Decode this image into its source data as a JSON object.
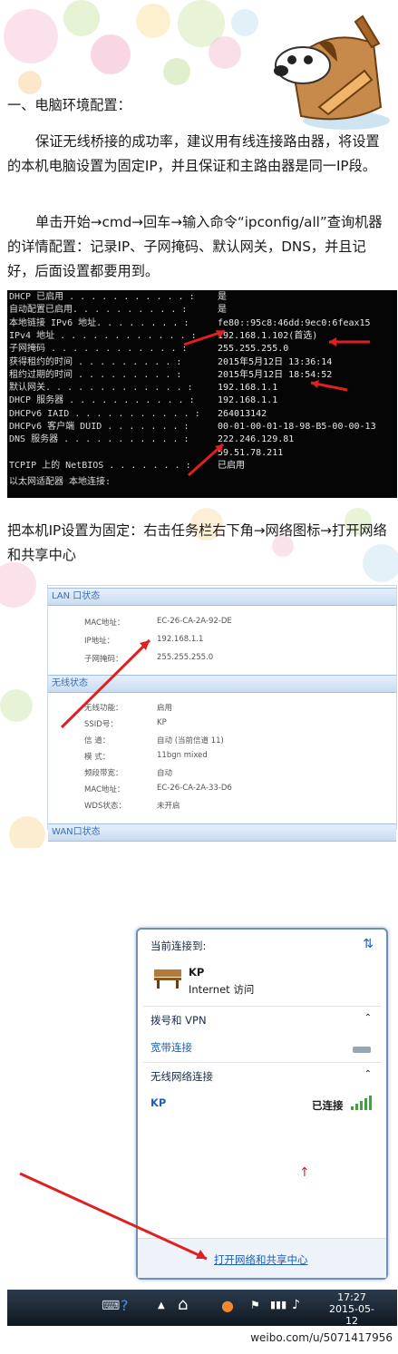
{
  "section_title": "一、电脑环境配置：",
  "para1": "保证无线桥接的成功率，建议用有线连接路由器，将设置的本机电脑设置为固定IP，并且保证和主路由器是同一IP段。",
  "para2": "单击开始→cmd→回车→输入命令“ipconfig/all”查询机器的详情配置：记录IP、子网掩码、默认网关，DNS，并且记好，后面设置都要用到。",
  "cmd": {
    "rows": [
      {
        "k": "DHCP 已启用 . . . . . . . . . . . :",
        "v": "是"
      },
      {
        "k": "自动配置已启用. . . . . . . . . . :",
        "v": "是"
      },
      {
        "k": "本地链接 IPv6 地址. . . . . . . . :",
        "v": "fe80::95c8:46dd:9ec0:6feax15"
      },
      {
        "k": "IPv4 地址 . . . . . . . . . . . . :",
        "v": "192.168.1.102(首选)"
      },
      {
        "k": "子网掩码 . . . . . . . . . . . . :",
        "v": "255.255.255.0"
      },
      {
        "k": "获得租约的时间 . . . . . . . . . :",
        "v": "2015年5月12日 13:36:14"
      },
      {
        "k": "租约过期的时间 . . . . . . . . . :",
        "v": "2015年5月12日 18:54:52"
      },
      {
        "k": "默认网关. . . . . . . . . . . . . :",
        "v": "192.168.1.1"
      },
      {
        "k": "DHCP 服务器 . . . . . . . . . . . :",
        "v": "192.168.1.1"
      },
      {
        "k": "DHCPv6 IAID . . . . . . . . . . . :",
        "v": "264013142"
      },
      {
        "k": "DHCPv6 客户端 DUID . . . . . . . :",
        "v": "00-01-00-01-18-98-B5-00-00-13"
      },
      {
        "k": "DNS 服务器 . . . . . . . . . . . :",
        "v": "222.246.129.81"
      },
      {
        "k": "",
        "v": "59.51.78.211"
      },
      {
        "k": "TCPIP 上的 NetBIOS . . . . . . . :",
        "v": "已启用"
      }
    ],
    "footer": "以太网适配器 本地连接:"
  },
  "para3": "把本机IP设置为固定：右击任务栏右下角→网络图标→打开网络和共享中心",
  "router": {
    "lan_header": "LAN 口状态",
    "lan_rows": [
      {
        "k": "MAC地址：",
        "v": "EC-26-CA-2A-92-DE"
      },
      {
        "k": "IP地址：",
        "v": "192.168.1.1"
      },
      {
        "k": "子网掩码：",
        "v": "255.255.255.0"
      }
    ],
    "wlan_header": "无线状态",
    "wlan_rows": [
      {
        "k": "无线功能：",
        "v": "启用"
      },
      {
        "k": "SSID号：",
        "v": "KP"
      },
      {
        "k": "信 道：",
        "v": "自动 (当前信道 11)"
      },
      {
        "k": "模 式：",
        "v": "11bgn mixed"
      },
      {
        "k": "频段带宽：",
        "v": "自动"
      },
      {
        "k": "MAC地址：",
        "v": "EC-26-CA-2A-33-D6"
      },
      {
        "k": "WDS状态：",
        "v": "未开启"
      }
    ],
    "wan_header": "WAN口状态"
  },
  "popup": {
    "current_label": "当前连接到:",
    "network_name": "KP",
    "network_access": "Internet 访问",
    "dialup_header": "拨号和 VPN",
    "broadband": "宽带连接",
    "wireless_header": "无线网络连接",
    "wifi_name": "KP",
    "wifi_status": "已连接",
    "open_center": "打开网络和共享中心"
  },
  "taskbar": {
    "time": "17:27",
    "date": "2015-05-12"
  },
  "watermark": "weibo.com/u/5071417956",
  "colors": {
    "cmd_bg": "#050505",
    "router_header": "#c8dcf1",
    "popup_border": "#6e8fb6",
    "link": "#1f5fb5",
    "arrow": "#e02020"
  }
}
